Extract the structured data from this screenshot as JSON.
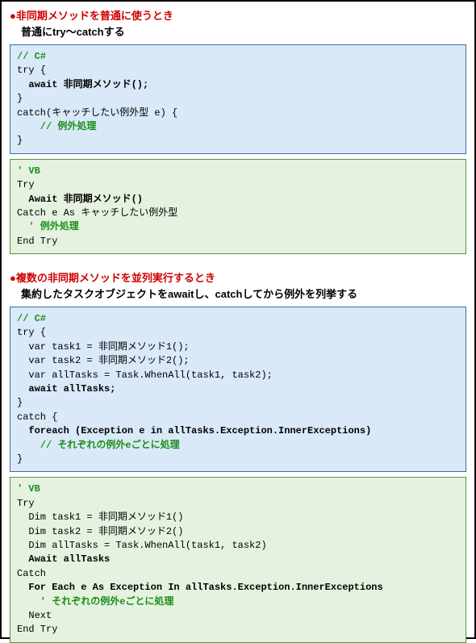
{
  "section1": {
    "bullet": "●",
    "title": "非同期メソッドを普通に使うとき",
    "subtitle": "普通にtry～catchする",
    "csharp": {
      "c1": "// C#",
      "l1": "try {",
      "l2": "  await 非同期メソッド();",
      "l3": "}",
      "l4": "catch(キャッチしたい例外型 e) {",
      "c2": "    // 例外処理",
      "l5": "}"
    },
    "vb": {
      "c1": "' VB",
      "l1": "Try",
      "l2": "  Await 非同期メソッド()",
      "l3": "Catch e As キャッチしたい例外型",
      "c2": "  ' 例外処理",
      "l4": "End Try"
    }
  },
  "section2": {
    "bullet": "●",
    "title": "複数の非同期メソッドを並列実行するとき",
    "subtitle": "集約したタスクオブジェクトをawaitし、catchしてから例外を列挙する",
    "csharp": {
      "c1": "// C#",
      "l1": "try {",
      "l2": "  var task1 = 非同期メソッド1();",
      "l3": "  var task2 = 非同期メソッド2();",
      "l4": "  var allTasks = Task.WhenAll(task1, task2);",
      "l5": "  await allTasks;",
      "l6": "}",
      "l7": "catch {",
      "l8": "  foreach (Exception e in allTasks.Exception.InnerExceptions)",
      "c2": "    // それぞれの例外eごとに処理",
      "l9": "}"
    },
    "vb": {
      "c1": "' VB",
      "l1": "Try",
      "l2": "  Dim task1 = 非同期メソッド1()",
      "l3": "  Dim task2 = 非同期メソッド2()",
      "l4": "  Dim allTasks = Task.WhenAll(task1, task2)",
      "l5": "  Await allTasks",
      "l6": "Catch",
      "l7": "  For Each e As Exception In allTasks.Exception.InnerExceptions",
      "c2": "    ' それぞれの例外eごとに処理",
      "l8": "  Next",
      "l9": "End Try"
    }
  }
}
